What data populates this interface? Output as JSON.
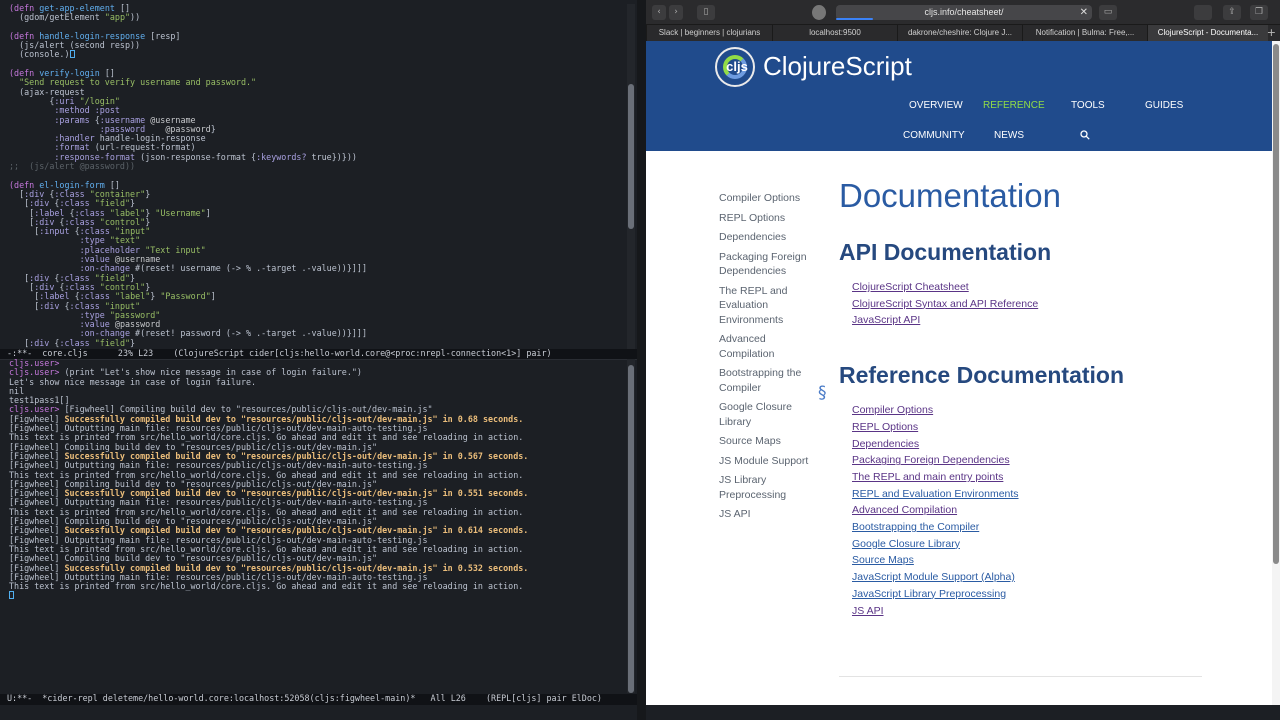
{
  "emacs": {
    "code_lines": [
      "(defn get-app-element []",
      "  (gdom/getElement \"app\"))",
      "",
      "(defn handle-login-response [resp]",
      "  (js/alert (second resp))",
      "  (console.)",
      "",
      "(defn verify-login []",
      "  \"Send request to verify username and password.\"",
      "  (ajax-request",
      "        {:uri \"/login\"",
      "         :method :post",
      "         :params {:username @username",
      "                  :password    @password}",
      "         :handler handle-login-response",
      "         :format (url-request-format)",
      "         :response-format (json-response-format {:keywords? true})}))",
      ";;  (js/alert @password))",
      "",
      "(defn el-login-form []",
      "  [:div {:class \"container\"}",
      "   [:div {:class \"field\"}",
      "    [:label {:class \"label\"} \"Username\"]",
      "    [:div {:class \"control\"}",
      "     [:input {:class \"input\"",
      "              :type \"text\"",
      "              :placeholder \"Text input\"",
      "              :value @username",
      "              :on-change #(reset! username (-> % .-target .-value))}]]]",
      "   [:div {:class \"field\"}",
      "    [:div {:class \"control\"}",
      "     [:label {:class \"label\"} \"Password\"]",
      "     [:div {:class \"input\"",
      "              :type \"password\"",
      "              :value @password",
      "              :on-change #(reset! password (-> % .-target .-value))}]]]",
      "   [:div {:class \"field\"}"
    ],
    "modeline_top": "-:**-  core.cljs      23% L23    (ClojureScript cider[cljs:hello-world.core@<proc:nrepl-connection<1>] pair)",
    "repl_lines": [
      "cljs.user>",
      "cljs.user> (print \"Let's show nice message in case of login failure.\")",
      "Let's show nice message in case of login failure.",
      "nil",
      "test1pass1[]",
      "cljs.user> [Figwheel] Compiling build dev to \"resources/public/cljs-out/dev-main.js\"",
      "[Figwheel] Successfully compiled build dev to \"resources/public/cljs-out/dev-main.js\" in 0.68 seconds.",
      "[Figwheel] Outputting main file: resources/public/cljs-out/dev-main-auto-testing.js",
      "This text is printed from src/hello_world/core.cljs. Go ahead and edit it and see reloading in action.",
      "[Figwheel] Compiling build dev to \"resources/public/cljs-out/dev-main.js\"",
      "[Figwheel] Successfully compiled build dev to \"resources/public/cljs-out/dev-main.js\" in 0.567 seconds.",
      "[Figwheel] Outputting main file: resources/public/cljs-out/dev-main-auto-testing.js",
      "This text is printed from src/hello_world/core.cljs. Go ahead and edit it and see reloading in action.",
      "[Figwheel] Compiling build dev to \"resources/public/cljs-out/dev-main.js\"",
      "[Figwheel] Successfully compiled build dev to \"resources/public/cljs-out/dev-main.js\" in 0.551 seconds.",
      "[Figwheel] Outputting main file: resources/public/cljs-out/dev-main-auto-testing.js",
      "This text is printed from src/hello_world/core.cljs. Go ahead and edit it and see reloading in action.",
      "[Figwheel] Compiling build dev to \"resources/public/cljs-out/dev-main.js\"",
      "[Figwheel] Successfully compiled build dev to \"resources/public/cljs-out/dev-main.js\" in 0.614 seconds.",
      "[Figwheel] Outputting main file: resources/public/cljs-out/dev-main-auto-testing.js",
      "This text is printed from src/hello_world/core.cljs. Go ahead and edit it and see reloading in action.",
      "[Figwheel] Compiling build dev to \"resources/public/cljs-out/dev-main.js\"",
      "[Figwheel] Successfully compiled build dev to \"resources/public/cljs-out/dev-main.js\" in 0.532 seconds.",
      "[Figwheel] Outputting main file: resources/public/cljs-out/dev-main-auto-testing.js",
      "This text is printed from src/hello_world/core.cljs. Go ahead and edit it and see reloading in action."
    ],
    "modeline_bottom": "U:**-  *cider-repl deleteme/hello-world.core:localhost:52058(cljs:figwheel-main)*   All L26    (REPL[cljs] pair ElDoc)"
  },
  "browser": {
    "url": "cljs.info/cheatsheet/",
    "tabs": [
      "Slack | beginners | clojurians",
      "localhost:9500",
      "dakrone/cheshire: Clojure J...",
      "Notification | Bulma: Free,...",
      "ClojureScript - Documenta..."
    ],
    "active_tab": 4,
    "site": {
      "logo_text": "cljs",
      "name": "ClojureScript",
      "nav": [
        "OVERVIEW",
        "REFERENCE",
        "TOOLS",
        "GUIDES",
        "COMMUNITY",
        "NEWS"
      ],
      "active_nav": "REFERENCE"
    },
    "sidebar": [
      "Compiler Options",
      "REPL Options",
      "Dependencies",
      "Packaging Foreign Dependencies",
      "The REPL and Evaluation Environments",
      "Advanced Compilation",
      "Bootstrapping the Compiler",
      "Google Closure Library",
      "Source Maps",
      "JS Module Support",
      "JS Library Preprocessing",
      "JS API"
    ],
    "title": "Documentation",
    "api_section": {
      "title": "API Documentation",
      "links": [
        "ClojureScript Cheatsheet",
        "ClojureScript Syntax and API Reference",
        "JavaScript API"
      ]
    },
    "ref_section": {
      "mark": "§",
      "title": "Reference Documentation",
      "links": [
        "Compiler Options",
        "REPL Options",
        "Dependencies",
        "Packaging Foreign Dependencies",
        "The REPL and main entry points",
        "REPL and Evaluation Environments",
        "Advanced Compilation",
        "Bootstrapping the Compiler",
        "Google Closure Library",
        "Source Maps",
        "JavaScript Module Support (Alpha)",
        "JavaScript Library Preprocessing",
        "JS API"
      ],
      "visited": [
        true,
        true,
        true,
        true,
        true,
        false,
        true,
        false,
        false,
        false,
        false,
        false,
        true
      ]
    }
  },
  "icons": {
    "back": "chevron-left-icon",
    "forward": "chevron-right-icon",
    "sidebar": "sidebar-icon",
    "search": "magnifier-icon"
  }
}
